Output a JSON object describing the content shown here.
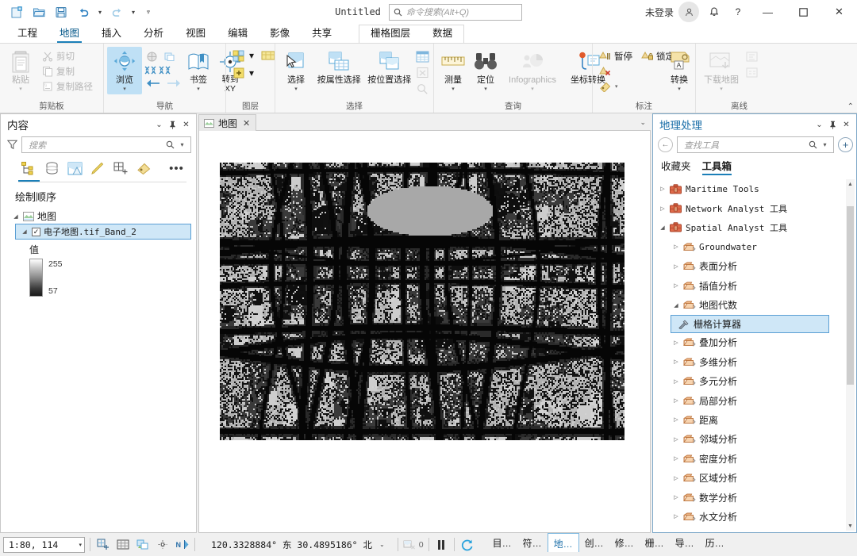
{
  "titlebar": {
    "doc_title": "Untitled",
    "search_placeholder": "命令搜索(Alt+Q)",
    "signin_label": "未登录",
    "quick_access": [
      {
        "name": "new-project-icon"
      },
      {
        "name": "open-project-icon"
      },
      {
        "name": "save-project-icon"
      },
      {
        "name": "undo-icon"
      },
      {
        "name": "redo-icon"
      },
      {
        "name": "customize-qat-icon"
      }
    ],
    "window_buttons": {
      "minimize": "—",
      "maximize": "▫",
      "close": "✕"
    }
  },
  "ribbon": {
    "tabs": [
      {
        "label": "工程",
        "active": false
      },
      {
        "label": "地图",
        "active": true
      },
      {
        "label": "插入",
        "active": false
      },
      {
        "label": "分析",
        "active": false
      },
      {
        "label": "视图",
        "active": false
      },
      {
        "label": "编辑",
        "active": false
      },
      {
        "label": "影像",
        "active": false
      },
      {
        "label": "共享",
        "active": false
      }
    ],
    "contextual_tabs": [
      {
        "label": "栅格图层",
        "active": false
      },
      {
        "label": "数据",
        "active": false
      }
    ],
    "groups": {
      "clipboard": {
        "label": "剪贴板",
        "paste": "粘贴",
        "cut": "剪切",
        "copy": "复制",
        "copy_path": "复制路径"
      },
      "navigate": {
        "label": "导航",
        "explore": "浏览",
        "bookmarks": "书签",
        "goto_xy_line1": "转到",
        "goto_xy_line2": "XY"
      },
      "layer": {
        "label": "图层"
      },
      "selection": {
        "label": "选择",
        "select": "选择",
        "select_by_attributes": "按属性选择",
        "select_by_location": "按位置选择"
      },
      "inquiry": {
        "label": "查询",
        "measure": "测量",
        "locate": "定位",
        "infographics": "Infographics",
        "coordinate_conversion": "坐标转换"
      },
      "labeling": {
        "label": "标注",
        "pause": "暂停",
        "lock": "锁定",
        "convert": "转换"
      },
      "offline": {
        "label": "离线",
        "download_map": "下载地图"
      }
    }
  },
  "contents_panel": {
    "title": "内容",
    "search_placeholder": "搜索",
    "tool_icons": [
      "list-by-drawing-order-icon",
      "list-by-data-source-icon",
      "list-by-selection-icon",
      "list-by-editing-icon",
      "list-by-snapping-icon",
      "list-by-labeling-icon",
      "more-options-icon"
    ],
    "section_title": "绘制顺序",
    "map_node": "地图",
    "layer_node": "电子地图.tif_Band_2",
    "legend_title": "值",
    "legend_max": "255",
    "legend_min": "57"
  },
  "map_view": {
    "tab_label": "地图",
    "tab_close": "✕"
  },
  "status_bar": {
    "scale": "1:80, 114",
    "coordinates": "120.3328884° 东  30.4895186° 北",
    "selection_count": "0",
    "icons": [
      "add-new-map-icon",
      "grid-icon",
      "selection-tools-icon",
      "snapping-icon",
      "north-arrow-icon"
    ],
    "bottom_tabs": [
      {
        "label": "目…",
        "active": false
      },
      {
        "label": "符…",
        "active": false
      },
      {
        "label": "地…",
        "active": true
      },
      {
        "label": "创…",
        "active": false
      },
      {
        "label": "修…",
        "active": false
      },
      {
        "label": "栅…",
        "active": false
      },
      {
        "label": "导…",
        "active": false
      },
      {
        "label": "历…",
        "active": false
      }
    ]
  },
  "geoprocessing_panel": {
    "title": "地理处理",
    "search_placeholder": "查找工具",
    "tabs": [
      {
        "label": "收藏夹",
        "active": false
      },
      {
        "label": "工具箱",
        "active": true
      }
    ],
    "tree": [
      {
        "label": "Maritime Tools",
        "level": 0,
        "state": "collapsed",
        "icon": "toolbox-icon",
        "mono": true
      },
      {
        "label": "Network Analyst 工具",
        "level": 0,
        "state": "collapsed",
        "icon": "toolbox-icon",
        "mono": true
      },
      {
        "label": "Spatial Analyst 工具",
        "level": 0,
        "state": "expanded",
        "icon": "toolbox-icon",
        "mono": true
      },
      {
        "label": "Groundwater",
        "level": 1,
        "state": "collapsed",
        "icon": "toolset-icon",
        "mono": true
      },
      {
        "label": "表面分析",
        "level": 1,
        "state": "collapsed",
        "icon": "toolset-icon",
        "mono": false
      },
      {
        "label": "插值分析",
        "level": 1,
        "state": "collapsed",
        "icon": "toolset-icon",
        "mono": false
      },
      {
        "label": "地图代数",
        "level": 1,
        "state": "expanded",
        "icon": "toolset-icon",
        "mono": false
      },
      {
        "label": "栅格计算器",
        "level": 2,
        "state": "leaf",
        "icon": "tool-icon",
        "mono": false,
        "selected": true
      },
      {
        "label": "叠加分析",
        "level": 1,
        "state": "collapsed",
        "icon": "toolset-icon",
        "mono": false
      },
      {
        "label": "多维分析",
        "level": 1,
        "state": "collapsed",
        "icon": "toolset-icon",
        "mono": false
      },
      {
        "label": "多元分析",
        "level": 1,
        "state": "collapsed",
        "icon": "toolset-icon",
        "mono": false
      },
      {
        "label": "局部分析",
        "level": 1,
        "state": "collapsed",
        "icon": "toolset-icon",
        "mono": false
      },
      {
        "label": "距离",
        "level": 1,
        "state": "collapsed",
        "icon": "toolset-icon",
        "mono": false
      },
      {
        "label": "邻域分析",
        "level": 1,
        "state": "collapsed",
        "icon": "toolset-icon",
        "mono": false
      },
      {
        "label": "密度分析",
        "level": 1,
        "state": "collapsed",
        "icon": "toolset-icon",
        "mono": false
      },
      {
        "label": "区域分析",
        "level": 1,
        "state": "collapsed",
        "icon": "toolset-icon",
        "mono": false
      },
      {
        "label": "数学分析",
        "level": 1,
        "state": "collapsed",
        "icon": "toolset-icon",
        "mono": false
      },
      {
        "label": "水文分析",
        "level": 1,
        "state": "collapsed",
        "icon": "toolset-icon",
        "mono": false
      }
    ]
  },
  "colors": {
    "accent": "#1b7fb8",
    "panel_title": "#1b6ea8",
    "selection": "#cfe7f7",
    "ribbon_bg": "#f7f7f7",
    "highlight": "#bfe0f5"
  }
}
